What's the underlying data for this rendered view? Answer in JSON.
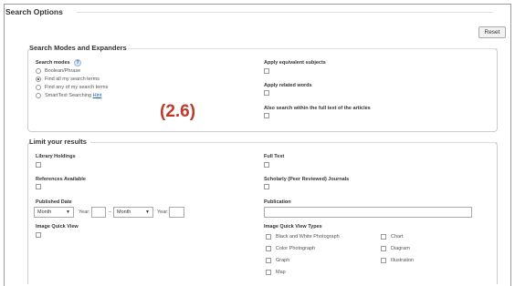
{
  "header": {
    "title": "Search Options",
    "reset_label": "Reset"
  },
  "modes": {
    "legend": "Search Modes and Expanders",
    "label": "Search modes",
    "help": "?",
    "options": [
      "Boolean/Phrase",
      "Find all my search terms",
      "Find any of my search terms",
      "SmartText Searching"
    ],
    "selected_index": 1,
    "hint_link": "Hint",
    "expanders": [
      "Apply equivalent subjects",
      "Apply related words",
      "Also search within the full text of the articles"
    ]
  },
  "annotation": "(2.6)",
  "limits": {
    "legend": "Limit your results",
    "library_holdings": "Library Holdings",
    "full_text": "Full Text",
    "references_available": "References Available",
    "scholarly": "Scholarly (Peer Reviewed) Journals",
    "published_date": "Published Date",
    "month_placeholder": "Month",
    "year_label": "Year:",
    "date_separator": "–",
    "publication": "Publication",
    "image_quick_view": "Image Quick View",
    "image_quick_view_types": "Image Quick View Types",
    "types_col1": [
      "Black and White Photograph",
      "Color Photograph",
      "Graph",
      "Map"
    ],
    "types_col2": [
      "Chart",
      "Diagram",
      "Illustration"
    ]
  }
}
